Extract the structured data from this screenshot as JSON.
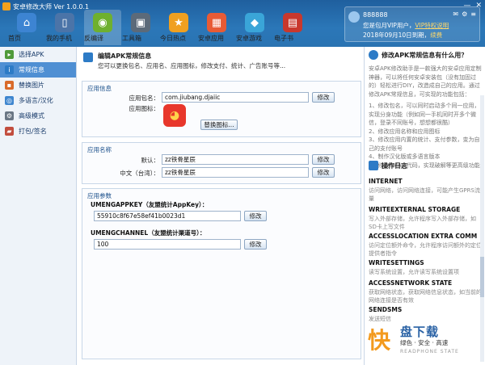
{
  "window": {
    "title": "安卓修改大师 Ver 1.0.0.1"
  },
  "tabs": [
    {
      "label": "首页",
      "icon": "home-icon",
      "color": "#3d84d2"
    },
    {
      "label": "我的手机",
      "icon": "phone-icon",
      "color": "#4b74a8"
    },
    {
      "label": "反编译",
      "icon": "android-icon",
      "color": "#6fb02f"
    },
    {
      "label": "工具箱",
      "icon": "toolbox-icon",
      "color": "#5c6a79"
    },
    {
      "label": "今日热点",
      "icon": "star-icon",
      "color": "#f0a020"
    },
    {
      "label": "安卓应用",
      "icon": "apps-icon",
      "color": "#e85b35"
    },
    {
      "label": "安卓游戏",
      "icon": "games-icon",
      "color": "#3aa5d8"
    },
    {
      "label": "电子书",
      "icon": "book-icon",
      "color": "#c9382d"
    }
  ],
  "user": {
    "name": "888888",
    "vip_text": "您是包月VIP用户，",
    "vip_link": "VIP特权说明",
    "expire_text": "2018年09月10日到期，",
    "renew_link": "续费"
  },
  "sidebar": {
    "items": [
      {
        "label": "选择APK",
        "icon": "select-apk-icon",
        "color": "#4f9a3a"
      },
      {
        "label": "常规信息",
        "icon": "info-icon",
        "color": "#2d7bc6"
      },
      {
        "label": "替换图片",
        "icon": "image-icon",
        "color": "#d96a2a"
      },
      {
        "label": "多语言/汉化",
        "icon": "globe-icon",
        "color": "#3f86cf"
      },
      {
        "label": "高级模式",
        "icon": "gear-icon",
        "color": "#6a7684"
      },
      {
        "label": "打包/签名",
        "icon": "package-icon",
        "color": "#c24d3e"
      }
    ],
    "active_index": 1
  },
  "main": {
    "title": "编辑APK常规信息",
    "subtitle": "您可以更换包名、应用名、应用图标，修改支付、统计、广告账号等...",
    "app_info": {
      "section_title": "应用信息",
      "package_label": "应用包名：",
      "package_value": "com.jiubang.djaiic",
      "modify_label": "修改",
      "icon_label": "应用图标：",
      "replace_icon_label": "替换图标..."
    },
    "app_name": {
      "section_title": "应用名称",
      "default_label": "默认：",
      "default_value": "zz铁骨星辰",
      "zh_tw_label": "中文（台湾）：",
      "zh_tw_value": "zz铁骨星辰",
      "modify_label": "修改"
    },
    "app_params": {
      "section_title": "应用参数",
      "params": [
        {
          "name": "UMENGAPPKEY（友盟统计AppKey）：",
          "value": "55910c8f67e58ef41b0023d1",
          "modify_label": "修改"
        },
        {
          "name": "UMENGCHANNEL（友盟统计渠道号）：",
          "value": "100",
          "modify_label": "修改"
        }
      ]
    }
  },
  "right": {
    "help_title": "修改APK常规信息有什么用？",
    "help_text": [
      "安卓APK修改助手是一款强大的安卓应用定制神器，可以将任何安卓安装包（没有加固过的）轻松进行DIY，改造成自己的应用。通过修改APK常规信息，可实现的功能包括：",
      "1、修改包名，可以同时启动多个同一应用，实现分身功能（例如同一手机同时开多个微信，登录不同账号，想想都很酷）",
      "2、修改应用名称和应用图标",
      "3、修改应用内置的统计、支付参数，变为自己的支付账号",
      "4、制作汉化版或多语言版本",
      "5、修改SMALI代码，实现破解等更高级功能"
    ],
    "log_title": "操作日志",
    "permissions": [
      {
        "name": "INTERNET",
        "desc": "访问网络，访问网络连接，可能产生GPRS流量"
      },
      {
        "name": "WRITEEXTERNAL STORAGE",
        "desc": "写入外部存储，允许程序写入外部存储，如SD卡上写文件"
      },
      {
        "name": "ACCESSLOCATION EXTRA COMM",
        "desc": "访问定位额外命令，允许程序访问额外的定位提供者指令"
      },
      {
        "name": "WRITESETTINGS",
        "desc": "读写系统设置，允许读写系统设置项"
      },
      {
        "name": "ACCESSNETWORK STATE",
        "desc": "获取网络状态，获取网络信息状态，如当前的网络连接是否有效"
      },
      {
        "name": "SENDSMS",
        "desc": "发送短信"
      }
    ]
  },
  "watermark": {
    "brand_char": "快",
    "brand_name": "盘下载",
    "slogan": "绿色 · 安全 · 高速",
    "english": "READPHONE STATE"
  }
}
